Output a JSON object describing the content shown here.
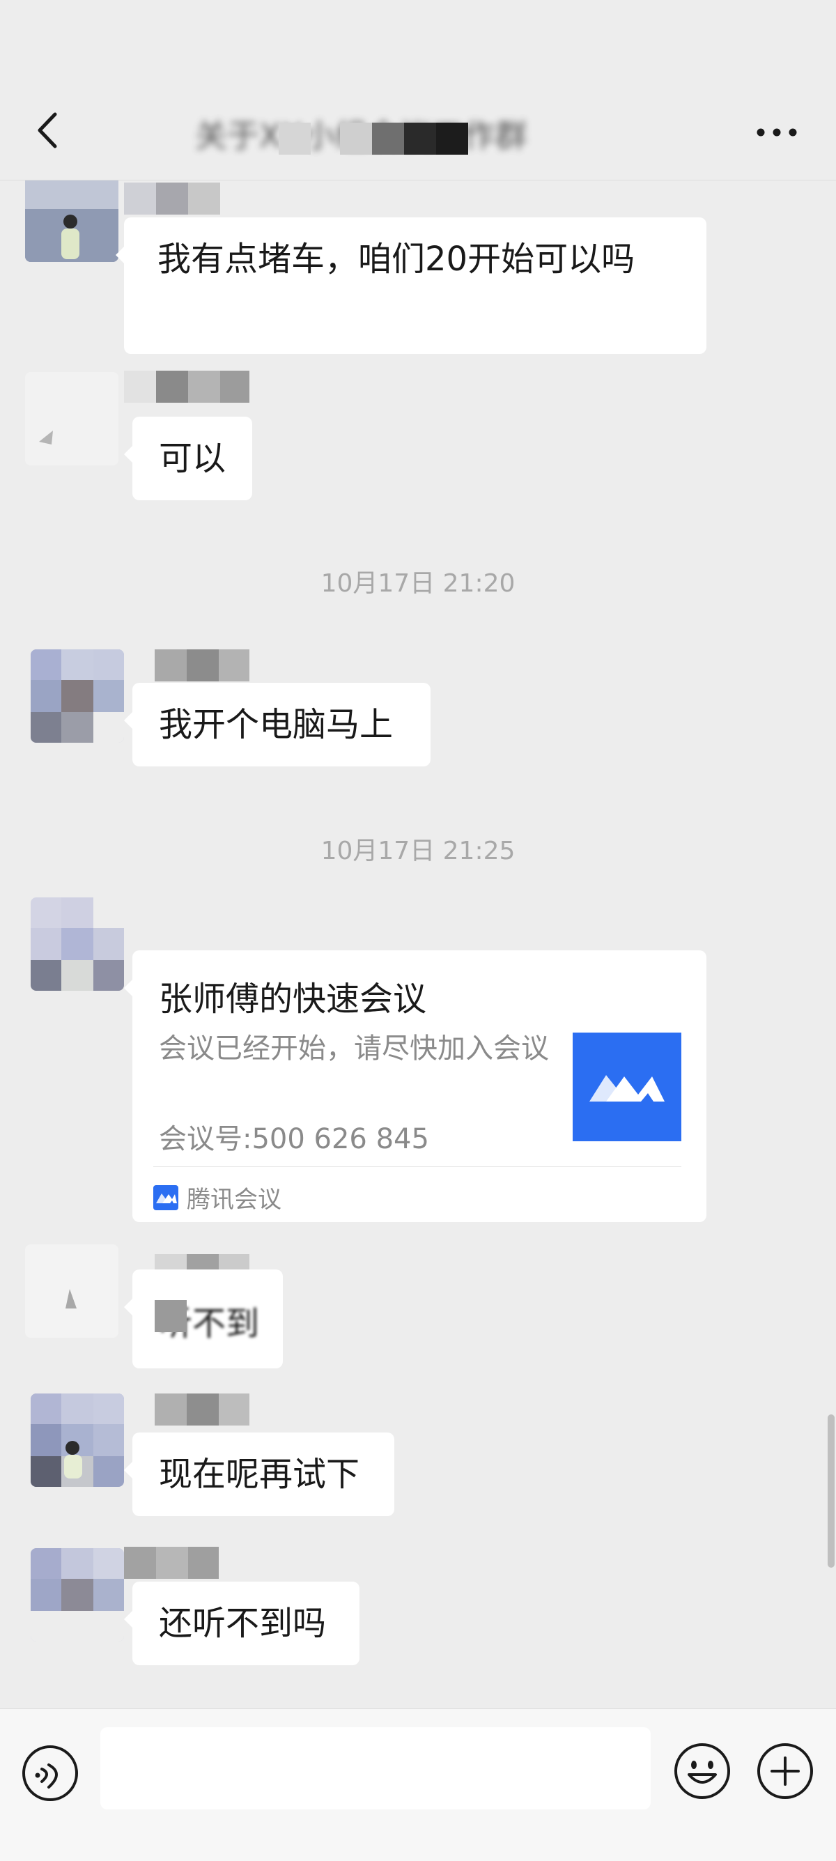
{
  "header": {
    "title": "关于XX小组会议工作群"
  },
  "messages": [
    {
      "text": "我有点堵车，咱们20开始可以吗"
    },
    {
      "text": "可以"
    },
    {
      "text": "我开个电脑马上"
    },
    {
      "text": "听不到"
    },
    {
      "text": "现在呢再试下"
    },
    {
      "text": "还听不到吗"
    }
  ],
  "timestamps": [
    "10月17日 21:20",
    "10月17日 21:25"
  ],
  "meeting_card": {
    "title": "张师傅的快速会议",
    "description": "会议已经开始，请尽快加入会议",
    "meeting_number": "会议号:500 626 845",
    "source": "腾讯会议",
    "accent_color": "#2B6EF2"
  },
  "icons": {
    "back": "chevron-left-icon",
    "more": "more-icon",
    "voice": "voice-icon",
    "emoji": "emoji-icon",
    "plus": "plus-icon"
  },
  "colors": {
    "background": "#EDEDED",
    "bubble": "#FFFFFF",
    "timestamp": "#A8A8A8",
    "brand": "#2B6EF2"
  }
}
